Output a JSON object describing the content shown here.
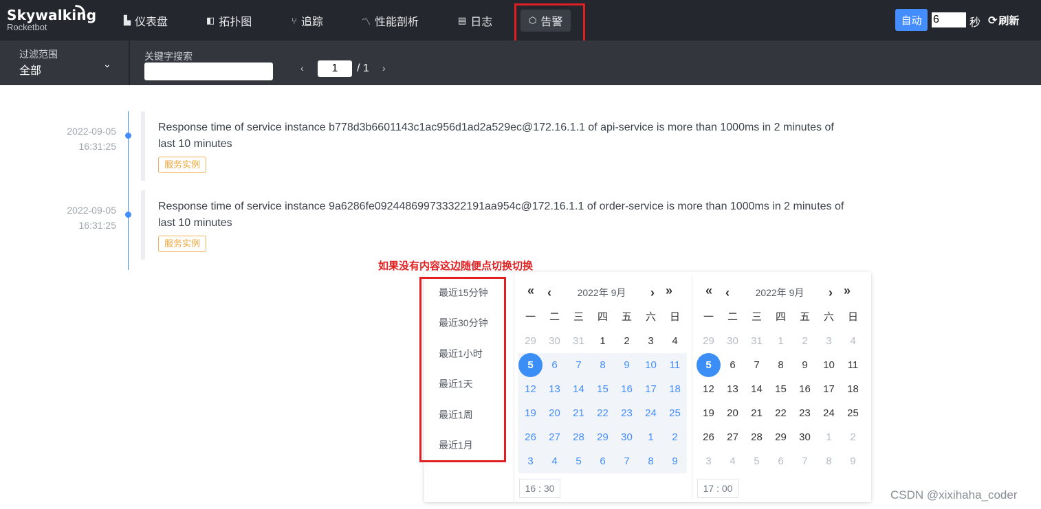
{
  "app": {
    "logo_name": "Skywalking",
    "logo_sub": "Rocketbot"
  },
  "nav": [
    {
      "label": "仪表盘",
      "icon": "dashboard-icon",
      "glyph": "▙"
    },
    {
      "label": "拓扑图",
      "icon": "topology-icon",
      "glyph": "◧"
    },
    {
      "label": "追踪",
      "icon": "trace-icon",
      "glyph": "⑂"
    },
    {
      "label": "性能剖析",
      "icon": "profile-icon",
      "glyph": "〽"
    },
    {
      "label": "日志",
      "icon": "log-icon",
      "glyph": "▤"
    },
    {
      "label": "告警",
      "icon": "alarm-icon",
      "glyph": "⬡",
      "active": true
    }
  ],
  "refresh": {
    "auto_label": "自动",
    "interval": "6",
    "unit": "秒",
    "refresh_label": "刷新"
  },
  "filter": {
    "scope_label": "过滤范围",
    "scope_value": "全部",
    "keyword_label": "关键字搜索",
    "keyword_value": "",
    "page": "1",
    "page_total": "/ 1"
  },
  "alarms": [
    {
      "date": "2022-09-05",
      "time": "16:31:25",
      "message": "Response time of service instance b778d3b6601143c1ac956d1ad2a529ec@172.16.1.1 of api-service is more than 1000ms in 2 minutes of last 10 minutes",
      "tag": "服务实例"
    },
    {
      "date": "2022-09-05",
      "time": "16:31:25",
      "message": "Response time of service instance 9a6286fe092448699733322191aa954c@172.16.1.1 of order-service is more than 1000ms in 2 minutes of last 10 minutes",
      "tag": "服务实例"
    }
  ],
  "annotation": "如果没有内容这边随便点切换切换",
  "picker": {
    "shortcuts": [
      "最近15分钟",
      "最近30分钟",
      "最近1小时",
      "最近1天",
      "最近1周",
      "最近1月"
    ],
    "weekdays": [
      "一",
      "二",
      "三",
      "四",
      "五",
      "六",
      "日"
    ],
    "calendars": [
      {
        "title": "2022年 9月",
        "time": "16 : 30",
        "days": [
          [
            "29",
            "30",
            "31",
            "1",
            "2",
            "3",
            "4"
          ],
          [
            "5",
            "6",
            "7",
            "8",
            "9",
            "10",
            "11"
          ],
          [
            "12",
            "13",
            "14",
            "15",
            "16",
            "17",
            "18"
          ],
          [
            "19",
            "20",
            "21",
            "22",
            "23",
            "24",
            "25"
          ],
          [
            "26",
            "27",
            "28",
            "29",
            "30",
            "1",
            "2"
          ],
          [
            "3",
            "4",
            "5",
            "6",
            "7",
            "8",
            "9"
          ]
        ]
      },
      {
        "title": "2022年 9月",
        "time": "17 : 00",
        "days": [
          [
            "29",
            "30",
            "31",
            "1",
            "2",
            "3",
            "4"
          ],
          [
            "5",
            "6",
            "7",
            "8",
            "9",
            "10",
            "11"
          ],
          [
            "12",
            "13",
            "14",
            "15",
            "16",
            "17",
            "18"
          ],
          [
            "19",
            "20",
            "21",
            "22",
            "23",
            "24",
            "25"
          ],
          [
            "26",
            "27",
            "28",
            "29",
            "30",
            "1",
            "2"
          ],
          [
            "3",
            "4",
            "5",
            "6",
            "7",
            "8",
            "9"
          ]
        ]
      }
    ]
  },
  "watermark": "CSDN @xixihaha_coder",
  "colors": {
    "accent": "#448dfe",
    "highlight_box": "#e02020",
    "tag": "#f0a63a"
  }
}
